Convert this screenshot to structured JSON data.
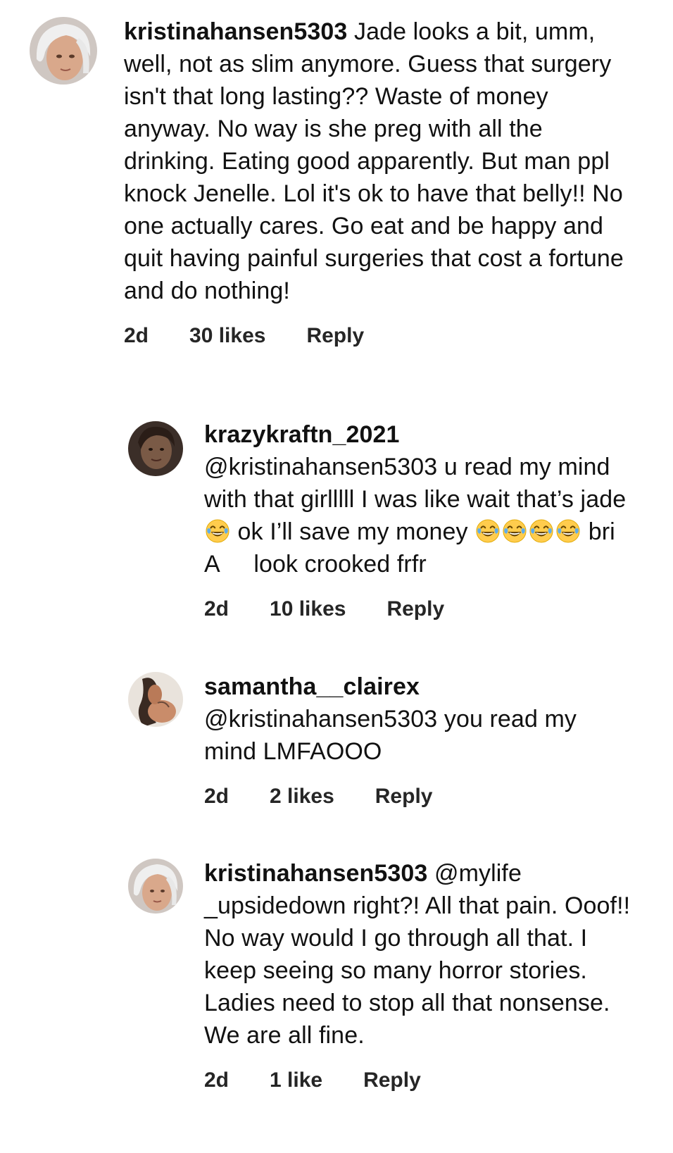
{
  "comments": [
    {
      "username": "kristinahansen5303",
      "text": "Jade looks a bit, umm, well, not as slim anymore. Guess that surgery isn't that long lasting?? Waste of money anyway. No way is she preg with all the drinking. Eating good apparently. But man ppl knock Jenelle. Lol it's ok to have that belly!! No one actually cares. Go eat and be happy and quit having painful surgeries that cost a fortune and do nothing!",
      "time": "2d",
      "likes": "30 likes",
      "reply": "Reply"
    },
    {
      "username": "krazykraftn_2021",
      "text_part1": "@kristinahansen5303 u read my mind with that girlllll I was like wait that’s jade",
      "text_part2": "ok I’ll save my money",
      "text_part3": "bri A",
      "text_part4": "look crooked frfr",
      "time": "2d",
      "likes": "10 likes",
      "reply": "Reply"
    },
    {
      "username": "samantha__clairex",
      "text": "@kristinahansen5303 you read my mind LMFAOOO",
      "time": "2d",
      "likes": "2 likes",
      "reply": "Reply"
    },
    {
      "username": "kristinahansen5303",
      "text": "@mylife _upsidedown right?! All that pain. Ooof!! No way would I go through all that. I keep seeing so many horror stories. Ladies need to stop all that nonsense. We are all fine.",
      "time": "2d",
      "likes": "1 like",
      "reply": "Reply"
    }
  ],
  "icons": {
    "emoji": "face-with-tears-of-joy-icon"
  },
  "colors": {
    "text": "#111111",
    "meta": "#262626",
    "background": "#ffffff"
  }
}
